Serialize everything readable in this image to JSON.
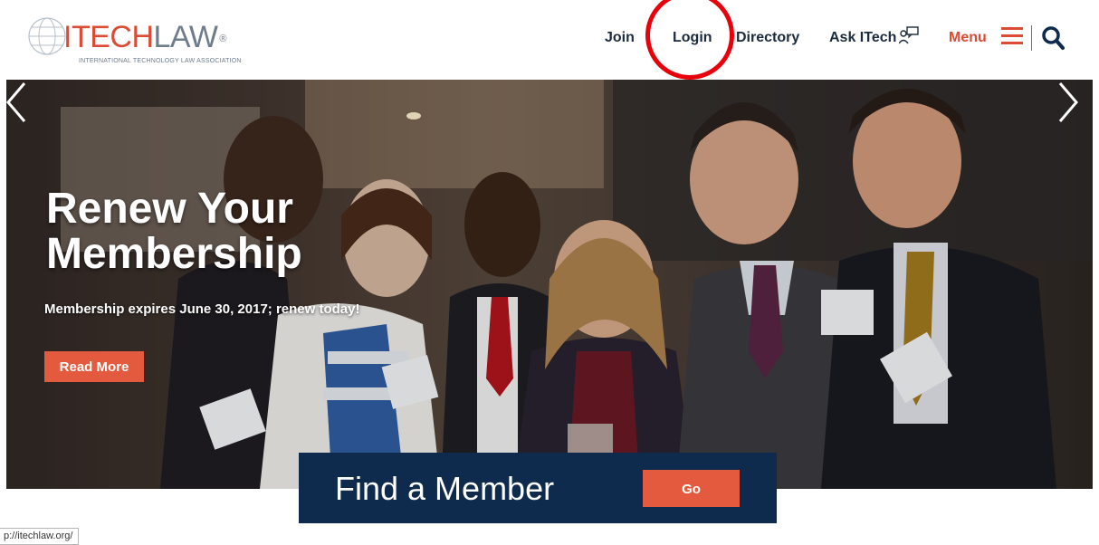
{
  "header": {
    "logo": {
      "brand_part1": "ITECH",
      "brand_part2": "LAW",
      "registered": "®",
      "tagline": "INTERNATIONAL TECHNOLOGY LAW ASSOCIATION"
    },
    "nav": {
      "join": "Join",
      "login": "Login",
      "directory": "Directory",
      "ask": "Ask ITech",
      "menu": "Menu"
    }
  },
  "hero": {
    "title_line1": "Renew Your",
    "title_line2": "Membership",
    "subtitle": "Membership expires June 30, 2017; renew today!",
    "button": "Read More"
  },
  "find_member": {
    "label": "Find a Member",
    "button": "Go"
  },
  "status_bar": {
    "url": "p://itechlaw.org/"
  },
  "colors": {
    "accent": "#e45a3e",
    "navy": "#0e2a4c",
    "annotation": "#e8000b"
  }
}
